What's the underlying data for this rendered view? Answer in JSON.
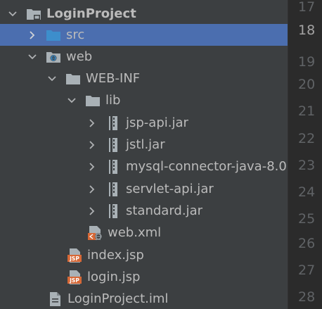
{
  "project_tree": {
    "items": [
      {
        "label": "LoginProject",
        "icon": "project-folder-icon"
      },
      {
        "label": "src",
        "icon": "source-folder-icon"
      },
      {
        "label": "web",
        "icon": "web-folder-icon"
      },
      {
        "label": "WEB-INF",
        "icon": "folder-icon"
      },
      {
        "label": "lib",
        "icon": "folder-icon"
      },
      {
        "label": "jsp-api.jar",
        "icon": "jar-icon"
      },
      {
        "label": "jstl.jar",
        "icon": "jar-icon"
      },
      {
        "label": "mysql-connector-java-8.0",
        "icon": "jar-icon"
      },
      {
        "label": "servlet-api.jar",
        "icon": "jar-icon"
      },
      {
        "label": "standard.jar",
        "icon": "jar-icon"
      },
      {
        "label": "web.xml",
        "icon": "web-xml-icon"
      },
      {
        "label": "index.jsp",
        "icon": "jsp-file-icon"
      },
      {
        "label": "login.jsp",
        "icon": "jsp-file-icon"
      },
      {
        "label": "LoginProject.iml",
        "icon": "iml-file-icon"
      }
    ],
    "selected_label": "src"
  },
  "editor_gutter": {
    "line_numbers": [
      "17",
      "18",
      "19",
      "20",
      "21",
      "22",
      "23",
      "24",
      "25",
      "26",
      "27",
      "28"
    ],
    "current_line": "18"
  },
  "colors": {
    "panel_background": "#3c3f41",
    "selection": "#4b6eaf",
    "text": "#bbbbbb",
    "gutter_background": "#2b2b2b",
    "line_number": "#606366",
    "folder": "#a9b1b6",
    "source_folder": "#3d8ecc",
    "jsp_badge": "#d76836"
  }
}
